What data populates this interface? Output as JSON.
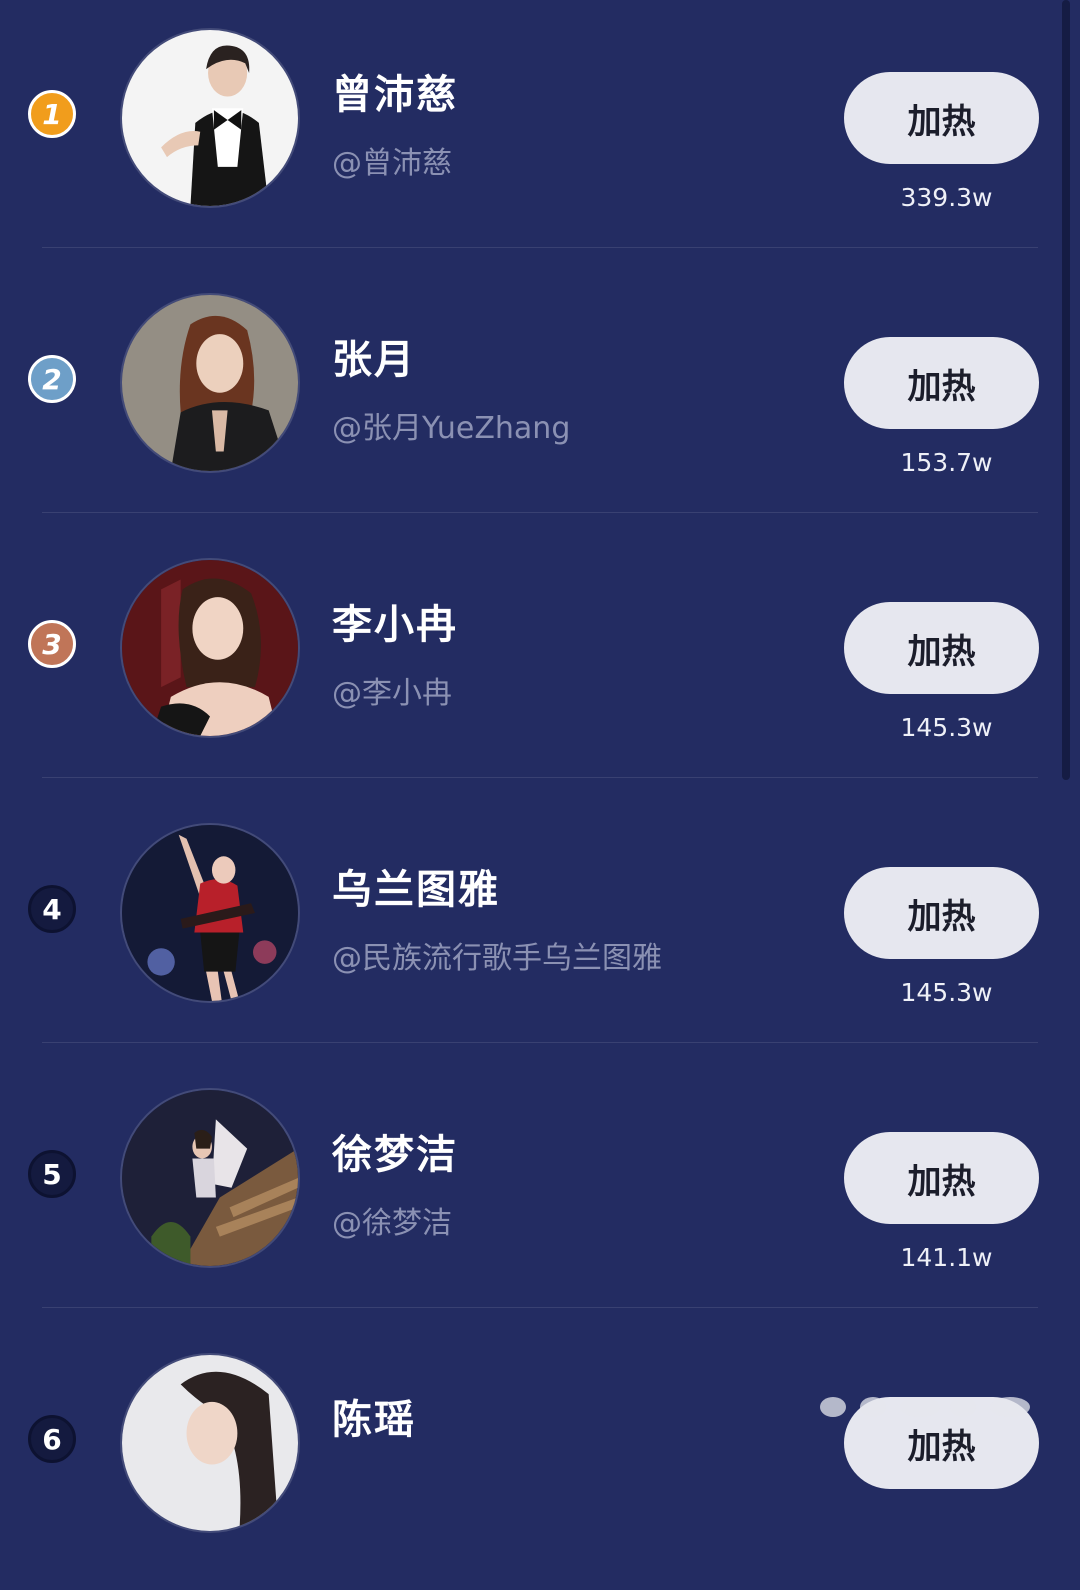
{
  "action_label": "加热",
  "rows": [
    {
      "rank": "1",
      "name": "曾沛慈",
      "handle": "@曾沛慈",
      "score": "339.3w",
      "medal_color": "#f19d1c"
    },
    {
      "rank": "2",
      "name": "张月",
      "handle": "@张月YueZhang",
      "score": "153.7w",
      "medal_color": "#6e9fc8"
    },
    {
      "rank": "3",
      "name": "李小冉",
      "handle": "@李小冉",
      "score": "145.3w",
      "medal_color": "#c07558"
    },
    {
      "rank": "4",
      "name": "乌兰图雅",
      "handle": "@民族流行歌手乌兰图雅",
      "score": "145.3w"
    },
    {
      "rank": "5",
      "name": "徐梦洁",
      "handle": "@徐梦洁",
      "score": "141.1w"
    },
    {
      "rank": "6",
      "name": "陈瑶"
    }
  ],
  "colors": {
    "background": "#232c62",
    "button_bg": "#e6e7ef",
    "handle_text": "#8b91b3"
  }
}
